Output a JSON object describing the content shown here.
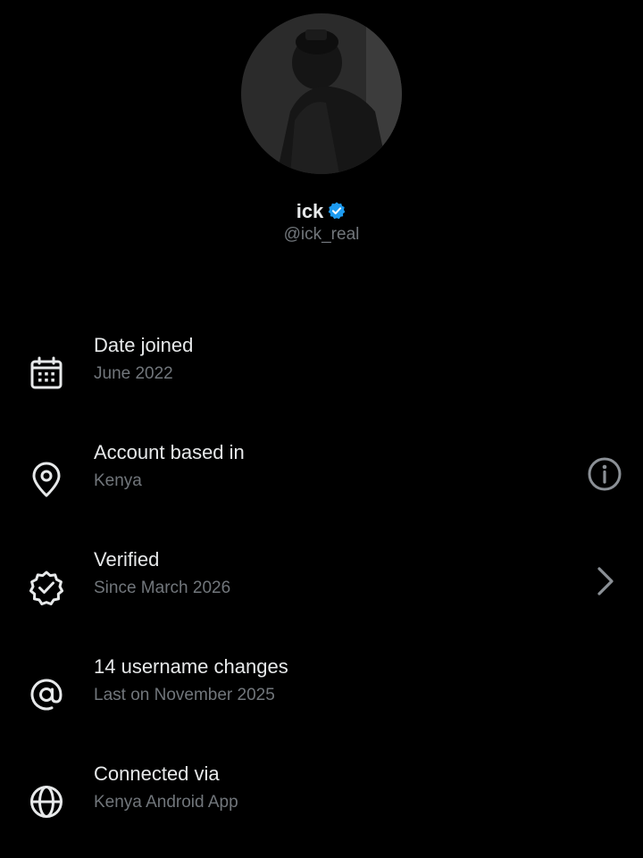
{
  "profile": {
    "name": "ick",
    "handle": "@ick_real",
    "verified_color": "#1d9bf0"
  },
  "items": [
    {
      "title": "Date joined",
      "subtitle": "June 2022",
      "icon": "calendar-icon"
    },
    {
      "title": "Account based in",
      "subtitle": "Kenya",
      "icon": "location-pin-icon",
      "trailing_icon": "info-icon"
    },
    {
      "title": "Verified",
      "subtitle": "Since March 2026",
      "icon": "verified-badge-icon",
      "trailing_icon": "chevron-right-icon"
    },
    {
      "title": "14 username changes",
      "subtitle": "Last on November 2025",
      "icon": "at-sign-icon"
    },
    {
      "title": "Connected via",
      "subtitle": "Kenya Android App",
      "icon": "globe-icon"
    }
  ],
  "colors": {
    "background": "#000000",
    "primary_text": "#e7e9ea",
    "secondary_text": "#71767b"
  }
}
